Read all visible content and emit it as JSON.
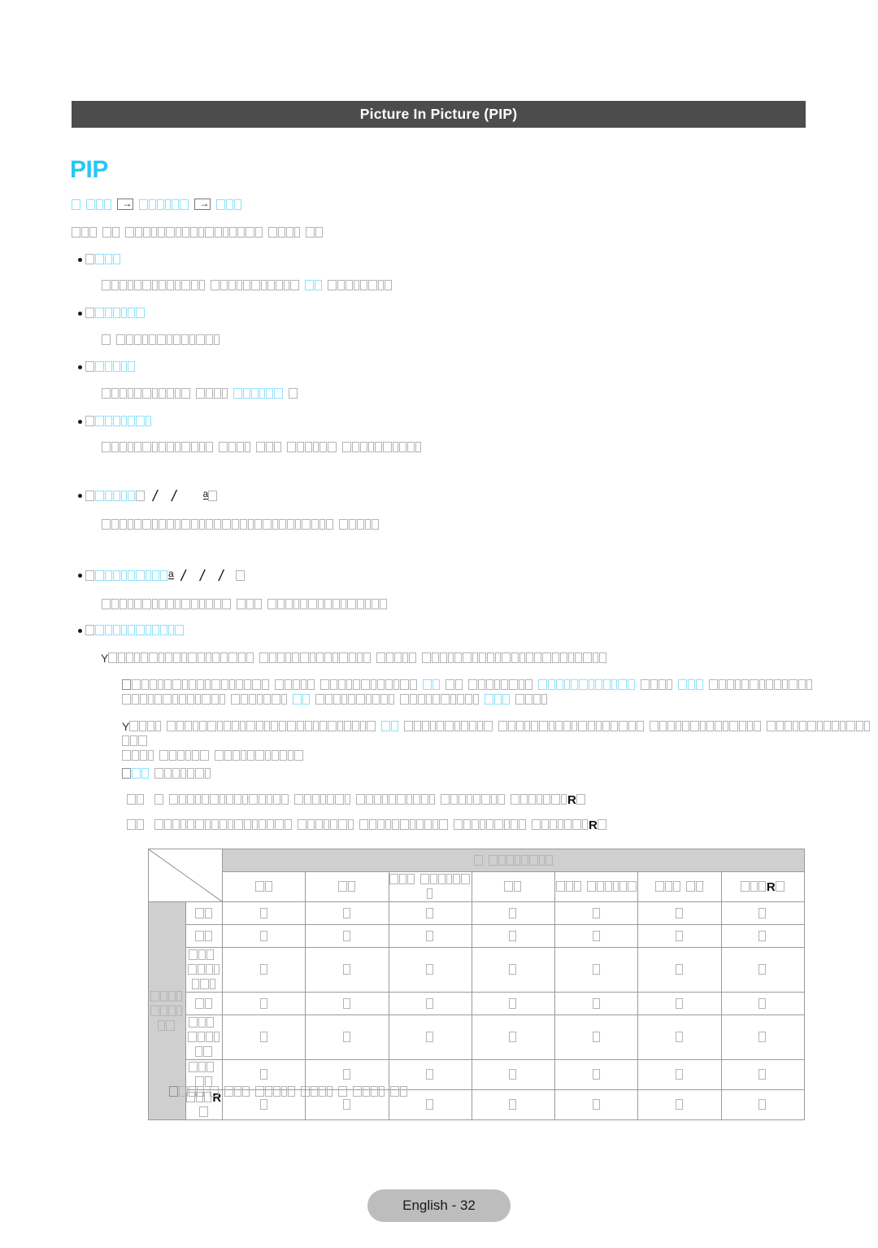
{
  "header": {
    "title": "Picture In Picture (PIP)"
  },
  "section": {
    "heading": "PIP",
    "heading_color": "#29c6f4"
  },
  "breadcrumb": {
    "segments": [
      {
        "glyphs": 1,
        "color": "cyan"
      },
      {
        "glyphs": 3,
        "color": "cyan"
      }
    ],
    "arrow_icon": "right-arrow-icon",
    "segment2_glyphs": 6,
    "segment3_glyphs": 3
  },
  "lead_text": {
    "runs": [
      {
        "glyphs": 3,
        "color": "gray"
      },
      {
        "glyphs": 2,
        "color": "gray"
      },
      {
        "glyphs": 17,
        "color": "gray"
      },
      {
        "glyphs": 4,
        "color": "gray"
      },
      {
        "glyphs": 2,
        "color": "gray"
      }
    ]
  },
  "items": [
    {
      "label_glyphs": 3,
      "label_color": "cyan",
      "body_runs": [
        {
          "glyphs": 13,
          "color": "gray"
        },
        {
          "glyphs": 11,
          "color": "gray"
        },
        {
          "glyphs": 2,
          "color": "cyan"
        },
        {
          "glyphs": 8,
          "color": "gray"
        }
      ]
    },
    {
      "label_glyphs": 6,
      "label_color": "cyan",
      "body_runs": [
        {
          "glyphs": 1,
          "color": "gray"
        },
        {
          "glyphs": 13,
          "color": "gray"
        }
      ]
    },
    {
      "label_glyphs": 5,
      "label_color": "cyan",
      "body_runs": [
        {
          "glyphs": 11,
          "color": "gray"
        },
        {
          "glyphs": 4,
          "color": "gray"
        },
        {
          "glyphs": 6,
          "color": "cyan"
        },
        {
          "glyphs": 1,
          "color": "gray"
        }
      ]
    },
    {
      "label_glyphs": 7,
      "label_color": "cyan",
      "body_runs": [
        {
          "glyphs": 14,
          "color": "gray"
        },
        {
          "glyphs": 4,
          "color": "gray"
        },
        {
          "glyphs": 3,
          "color": "gray"
        },
        {
          "glyphs": 6,
          "color": "gray"
        },
        {
          "glyphs": 10,
          "color": "gray"
        }
      ]
    }
  ],
  "ratio_item": {
    "label_glyphs": 5,
    "label_color": "cyan",
    "separator": "/",
    "separator_count": 2,
    "superscript": "a",
    "trailing_glyphs": 1,
    "body_runs": [
      {
        "glyphs": 29,
        "color": "gray"
      },
      {
        "glyphs": 5,
        "color": "gray"
      }
    ]
  },
  "size_item": {
    "label_glyphs": 9,
    "label_color": "cyan",
    "superscript": "a",
    "separator": "/",
    "separator_count": 3,
    "trailing_glyphs": 1,
    "body_runs": [
      {
        "glyphs": 16,
        "color": "gray"
      },
      {
        "glyphs": 3,
        "color": "gray"
      },
      {
        "glyphs": 15,
        "color": "gray"
      }
    ]
  },
  "source_item": {
    "label_glyphs": 11,
    "label_color": "cyan",
    "paragraphs": [
      {
        "lead_glyph": "Y",
        "runs": [
          {
            "glyphs": 18,
            "color": "gray"
          },
          {
            "glyphs": 14,
            "color": "gray"
          },
          {
            "glyphs": 5,
            "color": "gray"
          },
          {
            "glyphs": 23,
            "color": "gray"
          }
        ]
      }
    ],
    "notes": [
      {
        "icon": "note-box-icon",
        "lines": [
          [
            {
              "glyphs": 17,
              "color": "gray"
            },
            {
              "glyphs": 5,
              "color": "gray"
            },
            {
              "glyphs": 12,
              "color": "gray"
            },
            {
              "glyphs": 2,
              "color": "cyan"
            },
            {
              "glyphs": 2,
              "color": "gray"
            },
            {
              "glyphs": 8,
              "color": "gray"
            },
            {
              "glyphs": 12,
              "color": "cyan"
            },
            {
              "glyphs": 4,
              "color": "gray"
            },
            {
              "glyphs": 3,
              "color": "cyan"
            },
            {
              "glyphs": 13,
              "color": "gray"
            }
          ],
          [
            {
              "glyphs": 13,
              "color": "gray"
            },
            {
              "glyphs": 7,
              "color": "gray"
            },
            {
              "glyphs": 2,
              "color": "cyan"
            },
            {
              "glyphs": 10,
              "color": "gray"
            },
            {
              "glyphs": 10,
              "color": "gray"
            },
            {
              "glyphs": 3,
              "color": "cyan"
            },
            {
              "glyphs": 4,
              "color": "gray"
            }
          ]
        ]
      },
      {
        "icon": "note-y-icon",
        "lead_glyph": "Y",
        "lines": [
          [
            {
              "glyphs": 4,
              "color": "gray"
            },
            {
              "glyphs": 26,
              "color": "gray"
            },
            {
              "glyphs": 2,
              "color": "cyan"
            },
            {
              "glyphs": 11,
              "color": "gray"
            },
            {
              "glyphs": 18,
              "color": "gray"
            },
            {
              "glyphs": 14,
              "color": "gray"
            },
            {
              "glyphs": 16,
              "color": "gray"
            }
          ],
          [
            {
              "glyphs": 4,
              "color": "gray"
            },
            {
              "glyphs": 6,
              "color": "gray"
            },
            {
              "glyphs": 11,
              "color": "gray"
            }
          ]
        ]
      }
    ],
    "subheading": {
      "icon": "bracket-icon",
      "runs": [
        {
          "glyphs": 2,
          "color": "cyan"
        },
        {
          "glyphs": 7,
          "color": "gray"
        }
      ]
    },
    "numbered_lines": [
      {
        "marker_glyphs": 2,
        "runs": [
          {
            "glyphs": 1,
            "color": "gray"
          },
          {
            "glyphs": 15,
            "color": "gray"
          },
          {
            "glyphs": 7,
            "color": "gray"
          },
          {
            "glyphs": 10,
            "color": "gray"
          },
          {
            "glyphs": 8,
            "color": "gray"
          },
          {
            "glyphs": 7,
            "color": "gray"
          }
        ],
        "end_glyph": "R"
      },
      {
        "marker_glyphs": 2,
        "runs": [
          {
            "glyphs": 17,
            "color": "gray"
          },
          {
            "glyphs": 7,
            "color": "gray"
          },
          {
            "glyphs": 11,
            "color": "gray"
          },
          {
            "glyphs": 9,
            "color": "gray"
          },
          {
            "glyphs": 7,
            "color": "gray"
          }
        ],
        "end_glyph": "R"
      }
    ]
  },
  "table": {
    "corner": {
      "diagonal": true
    },
    "top_header": {
      "glyphs_a": 1,
      "glyphs_b": 8
    },
    "row_group_label": {
      "line1_glyphs": 4,
      "line2_glyphs": 6
    },
    "columns": [
      {
        "id": "col-1",
        "glyphs": 2,
        "special": null
      },
      {
        "id": "col-2",
        "glyphs": 2,
        "special": null
      },
      {
        "id": "col-3",
        "glyphs_a": 3,
        "glyphs_b": 7,
        "special": null
      },
      {
        "id": "col-4",
        "glyphs": 2,
        "special": null
      },
      {
        "id": "col-5",
        "glyphs_a": 3,
        "glyphs_b": 6,
        "special": null
      },
      {
        "id": "col-6",
        "glyphs_a": 3,
        "glyphs_b": 2,
        "special": null
      },
      {
        "id": "col-7",
        "glyphs_a": 3,
        "special": "R",
        "glyphs_b": 1
      }
    ],
    "rows": [
      {
        "id": "row-1",
        "glyphs": 2,
        "special": null
      },
      {
        "id": "row-2",
        "glyphs": 2,
        "special": null
      },
      {
        "id": "row-3",
        "glyphs_a": 3,
        "glyphs_b": 7,
        "special": null
      },
      {
        "id": "row-4",
        "glyphs": 2,
        "special": null
      },
      {
        "id": "row-5",
        "glyphs_a": 3,
        "glyphs_b": 6,
        "special": null
      },
      {
        "id": "row-6",
        "glyphs_a": 3,
        "glyphs_b": 2,
        "special": null
      },
      {
        "id": "row-7",
        "glyphs_a": 3,
        "special": "R",
        "glyphs_b": 1
      }
    ],
    "cell_glyph": "box",
    "cell_count": 49,
    "header_bg": "#cfcfcf",
    "border_color": "#9a9a9a"
  },
  "table_note": {
    "icon": "note-box-icon",
    "runs": [
      {
        "glyphs": 3,
        "color": "gray"
      },
      {
        "glyphs": 1,
        "color": "gray"
      },
      {
        "glyphs": 3,
        "color": "gray"
      },
      {
        "glyphs": 5,
        "color": "gray"
      },
      {
        "glyphs": 4,
        "color": "gray"
      },
      {
        "glyphs": 1,
        "color": "gray"
      },
      {
        "glyphs": 4,
        "color": "gray"
      },
      {
        "glyphs": 2,
        "color": "gray"
      }
    ]
  },
  "footer": {
    "label": "English - 32",
    "bg": "#bdbdbd"
  }
}
